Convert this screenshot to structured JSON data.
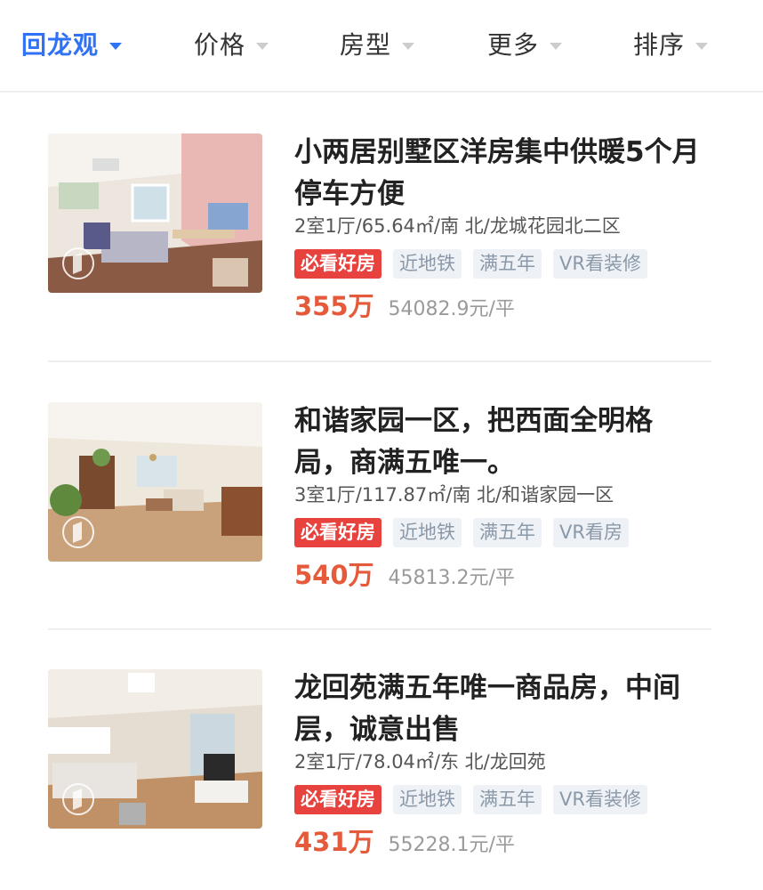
{
  "filters": [
    {
      "label": "回龙观",
      "active": true
    },
    {
      "label": "价格",
      "active": false
    },
    {
      "label": "房型",
      "active": false
    },
    {
      "label": "更多",
      "active": false
    },
    {
      "label": "排序",
      "active": false
    }
  ],
  "listings": [
    {
      "title": "小两居别墅区洋房集中供暖5个月停车方便",
      "meta": "2室1厅/65.64㎡/南 北/龙城花园北二区",
      "tags": [
        "必看好房",
        "近地铁",
        "满五年",
        "VR看装修"
      ],
      "total_price": "355万",
      "unit_price": "54082.9元/平"
    },
    {
      "title": "和谐家园一区，把西面全明格局，商满五唯一。",
      "meta": "3室1厅/117.87㎡/南 北/和谐家园一区",
      "tags": [
        "必看好房",
        "近地铁",
        "满五年",
        "VR看房"
      ],
      "total_price": "540万",
      "unit_price": "45813.2元/平"
    },
    {
      "title": "龙回苑满五年唯一商品房，中间层，诚意出售",
      "meta": "2室1厅/78.04㎡/东 北/龙回苑",
      "tags": [
        "必看好房",
        "近地铁",
        "满五年",
        "VR看装修"
      ],
      "total_price": "431万",
      "unit_price": "55228.1元/平"
    }
  ],
  "colors": {
    "accent": "#3072f6",
    "price": "#e55a3b",
    "hot_tag": "#e8423e",
    "plain_tag_bg": "#eef2f6"
  }
}
